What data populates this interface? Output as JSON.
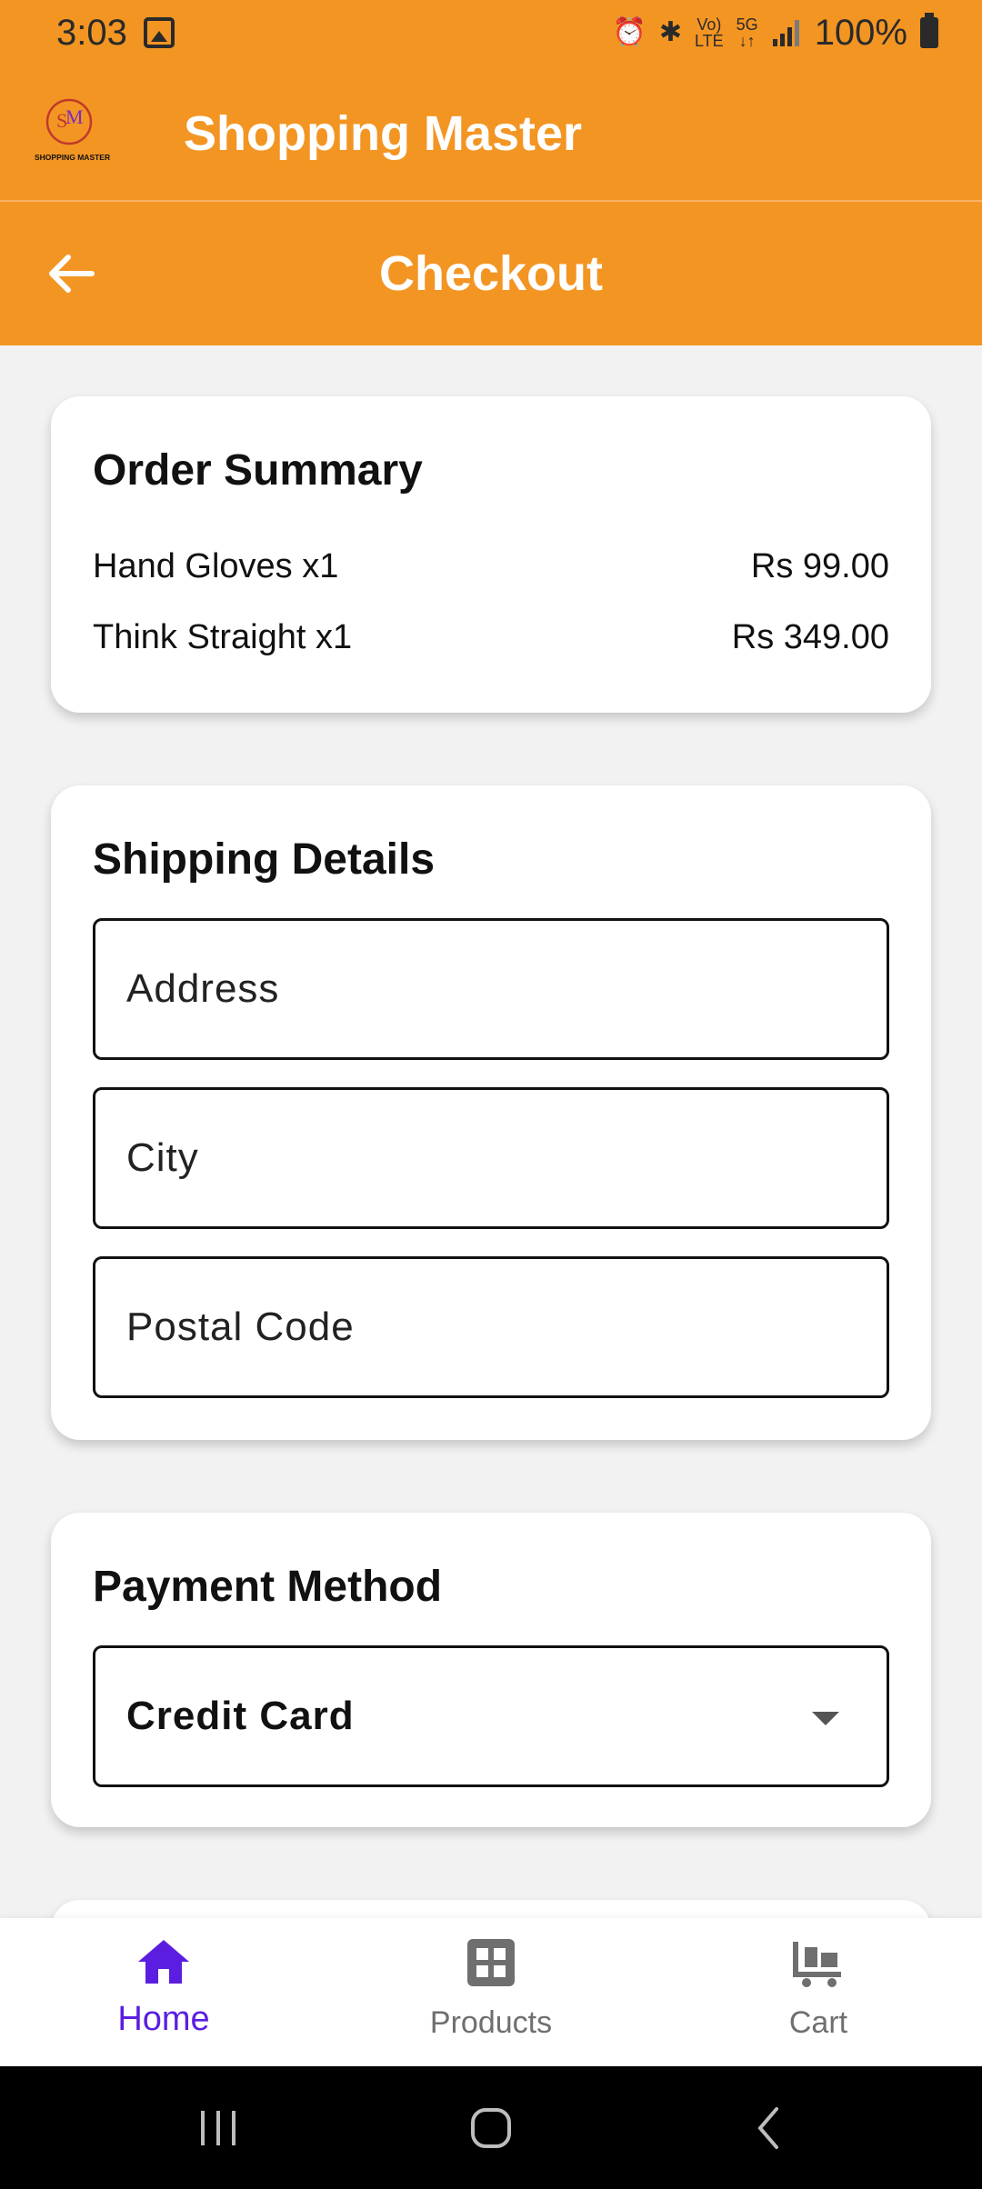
{
  "status_bar": {
    "time": "3:03",
    "battery_text": "100%",
    "icons": [
      "image-icon",
      "alarm-icon",
      "bluetooth-icon",
      "volte-icon",
      "5g-icon",
      "signal-icon",
      "battery-icon"
    ]
  },
  "app_bar": {
    "title": "Shopping Master",
    "logo_text": "SHOPPING MASTER",
    "logo_monogram": "SM"
  },
  "page_header": {
    "title": "Checkout",
    "back_icon": "arrow-left-icon"
  },
  "order_summary": {
    "title": "Order Summary",
    "items": [
      {
        "name": "Hand Gloves x1",
        "price": "Rs 99.00"
      },
      {
        "name": "Think Straight x1",
        "price": "Rs 349.00"
      }
    ]
  },
  "shipping": {
    "title": "Shipping Details",
    "address_placeholder": "Address",
    "city_placeholder": "City",
    "postal_placeholder": "Postal Code"
  },
  "payment": {
    "title": "Payment Method",
    "selected": "Credit Card"
  },
  "bottom_nav": {
    "items": [
      {
        "label": "Home",
        "icon": "home-icon",
        "active": true
      },
      {
        "label": "Products",
        "icon": "grid-icon",
        "active": false
      },
      {
        "label": "Cart",
        "icon": "cart-icon",
        "active": false
      }
    ]
  },
  "colors": {
    "brand_orange": "#f39523",
    "active_nav": "#5b1ee0"
  }
}
